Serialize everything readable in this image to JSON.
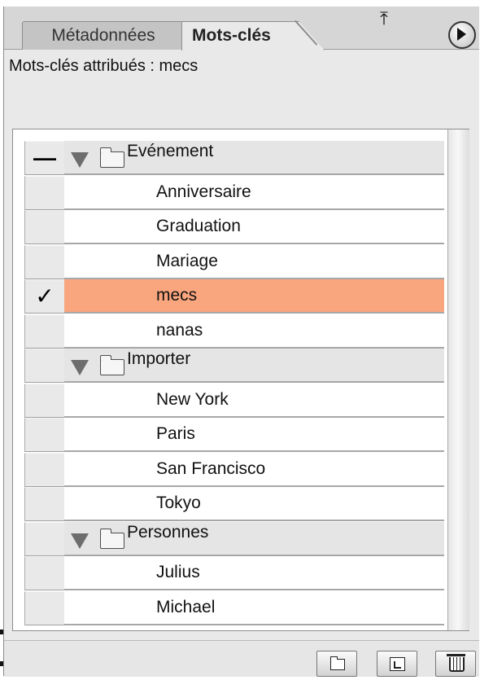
{
  "tabs": [
    {
      "label": "Métadonnées",
      "active": false
    },
    {
      "label": "Mots-clés",
      "active": true
    }
  ],
  "assigned_text": "Mots-clés attribués : mecs",
  "rows": [
    {
      "kind": "group",
      "label": "Evénement",
      "check": "—"
    },
    {
      "kind": "item",
      "label": "Anniversaire",
      "check": ""
    },
    {
      "kind": "item",
      "label": "Graduation",
      "check": ""
    },
    {
      "kind": "item",
      "label": "Mariage",
      "check": ""
    },
    {
      "kind": "item",
      "label": "mecs",
      "check": "✓",
      "selected": true
    },
    {
      "kind": "item",
      "label": "nanas",
      "check": ""
    },
    {
      "kind": "group",
      "label": "Importer",
      "check": ""
    },
    {
      "kind": "item",
      "label": "New York",
      "check": ""
    },
    {
      "kind": "item",
      "label": "Paris",
      "check": ""
    },
    {
      "kind": "item",
      "label": "San Francisco",
      "check": ""
    },
    {
      "kind": "item",
      "label": "Tokyo",
      "check": ""
    },
    {
      "kind": "group",
      "label": "Personnes",
      "check": ""
    },
    {
      "kind": "item",
      "label": "Julius",
      "check": ""
    },
    {
      "kind": "item",
      "label": "Michael",
      "check": ""
    }
  ],
  "footer_buttons": [
    {
      "icon": "new-folder-icon"
    },
    {
      "icon": "new-keyword-icon"
    },
    {
      "icon": "trash-icon"
    }
  ],
  "colors": {
    "selected_row": "#f9a57e",
    "panel_background": "#e9e9e9",
    "group_row": "#e5e5e5"
  }
}
